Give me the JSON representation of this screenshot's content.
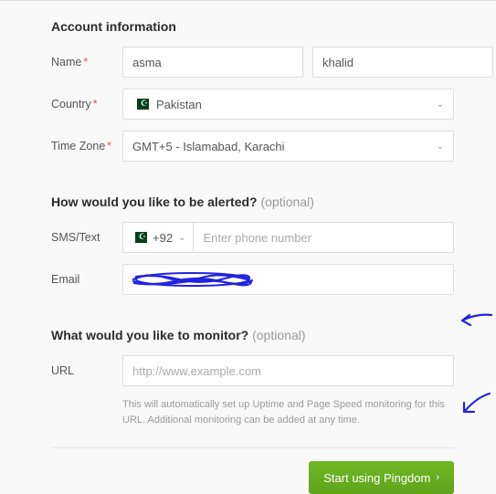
{
  "section1": {
    "title": "Account information",
    "name_label": "Name",
    "first_name": "asma",
    "last_name": "khalid",
    "country_label": "Country",
    "country_value": "Pakistan",
    "timezone_label": "Time Zone",
    "timezone_value": "GMT+5 - Islamabad, Karachi"
  },
  "section2": {
    "title": "How would you like to be alerted?",
    "optional": "(optional)",
    "sms_label": "SMS/Text",
    "dial_code": "+92",
    "phone_placeholder": "Enter phone number",
    "email_label": "Email"
  },
  "section3": {
    "title": "What would you like to monitor?",
    "optional": "(optional)",
    "url_label": "URL",
    "url_placeholder": "http://www.example.com",
    "helper": "This will automatically set up Uptime and Page Speed monitoring for this URL. Additional monitoring can be added at any time."
  },
  "actions": {
    "submit": "Start using Pingdom"
  }
}
